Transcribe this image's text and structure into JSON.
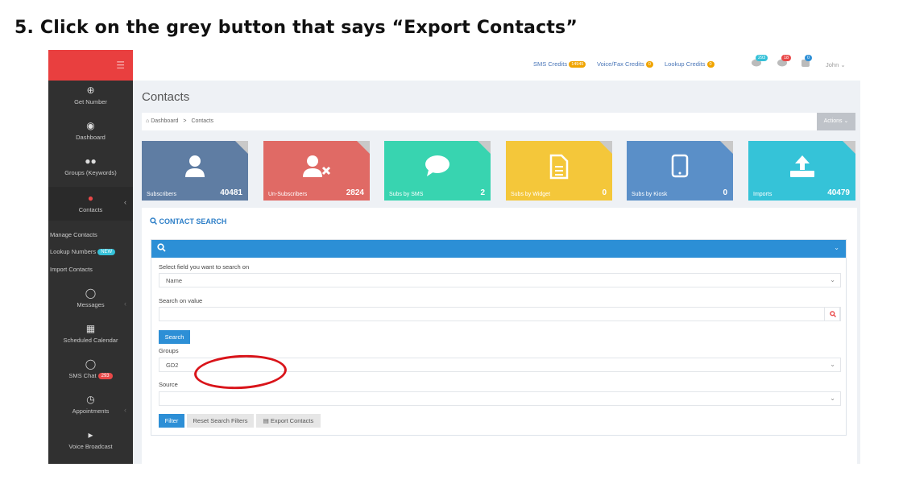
{
  "instruction": "5.  Click on the grey button that says “Export Contacts”",
  "sidebar": {
    "menu_icon": "hamburger-icon",
    "items": [
      {
        "label": "Get Number",
        "icon": "plus-circle-icon"
      },
      {
        "label": "Dashboard",
        "icon": "dashboard-icon"
      },
      {
        "label": "Groups (Keywords)",
        "icon": "users-icon"
      },
      {
        "label": "Contacts",
        "icon": "user-icon"
      },
      {
        "label": "Messages",
        "icon": "comment-icon"
      },
      {
        "label": "Scheduled Calendar",
        "icon": "calendar-icon"
      },
      {
        "label": "SMS Chat",
        "icon": "chat-icon",
        "badge": "293"
      },
      {
        "label": "Appointments",
        "icon": "clock-icon"
      },
      {
        "label": "Voice Broadcast",
        "icon": "megaphone-icon"
      }
    ],
    "sub_items": [
      {
        "label": "Manage Contacts"
      },
      {
        "label": "Lookup Numbers",
        "badge": "NEW"
      },
      {
        "label": "Import Contacts"
      }
    ]
  },
  "topbar": {
    "sms_credits_label": "SMS Credits",
    "sms_credits_value": "14945",
    "voice_fax_label": "Voice/Fax Credits",
    "voice_fax_value": "0",
    "lookup_label": "Lookup Credits",
    "lookup_value": "0",
    "chat_count": "293",
    "mail_count": "18",
    "notify_count": "0",
    "user_name": "John"
  },
  "page": {
    "title": "Contacts",
    "breadcrumb_home": "Dashboard",
    "breadcrumb_sep": ">",
    "breadcrumb_current": "Contacts",
    "actions_label": "Actions"
  },
  "tiles": [
    {
      "label": "Subscribers",
      "value": "40481",
      "color": "#5f7da3",
      "icon": "user-icon"
    },
    {
      "label": "Un-Subscribers",
      "value": "2824",
      "color": "#e06a65",
      "icon": "user-remove-icon"
    },
    {
      "label": "Subs by SMS",
      "value": "2",
      "color": "#38d4b0",
      "icon": "speech-bubble-icon"
    },
    {
      "label": "Subs by Widget",
      "value": "0",
      "color": "#f4c73a",
      "icon": "document-icon"
    },
    {
      "label": "Subs by Kiosk",
      "value": "0",
      "color": "#5a8fc8",
      "icon": "tablet-icon"
    },
    {
      "label": "Imports",
      "value": "40479",
      "color": "#35c3d8",
      "icon": "upload-icon"
    }
  ],
  "contact_search": {
    "title": "CONTACT SEARCH",
    "field_label": "Select field you want to search on",
    "field_value": "Name",
    "value_label": "Search on value",
    "value_input": "",
    "search_button": "Search",
    "groups_label": "Groups",
    "groups_value": "GD2",
    "source_label": "Source",
    "source_value": "",
    "filter_button": "Filter",
    "reset_button": "Reset Search Filters",
    "export_button": "Export Contacts"
  },
  "colors": {
    "accent_red": "#e93f3f",
    "sidebar_bg": "#303030",
    "primary_blue": "#2d8fd6",
    "highlight_ring": "#d9141a"
  }
}
